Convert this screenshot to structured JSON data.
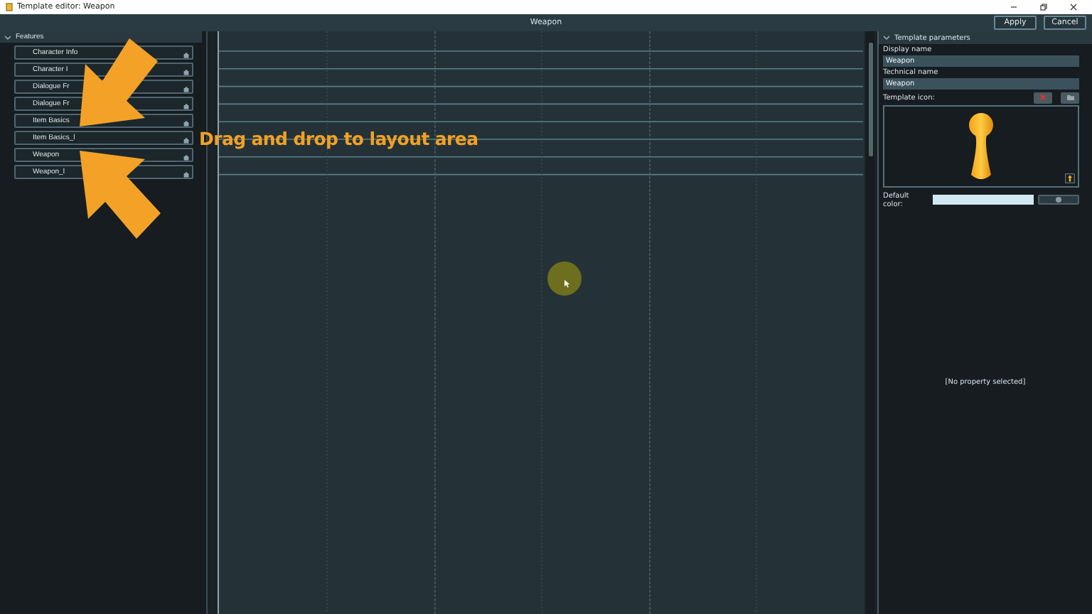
{
  "window": {
    "title": "Template editor: Weapon"
  },
  "toolbar": {
    "title": "Weapon",
    "buttons": [
      "Apply",
      "Cancel"
    ]
  },
  "features": {
    "header": "Features",
    "expanded": true,
    "items": [
      {
        "label": "Character Info"
      },
      {
        "label": "Character I"
      },
      {
        "label": "Dialogue Fr"
      },
      {
        "label": "Dialogue Fr"
      },
      {
        "label": "Item Basics"
      },
      {
        "label": "Item Basics_l"
      },
      {
        "label": "Weapon"
      },
      {
        "label": "Weapon_l"
      }
    ]
  },
  "params": {
    "header": "Template parameters",
    "expanded": true,
    "fields": [
      {
        "label": "Display name",
        "value": "Weapon"
      },
      {
        "label": "Technical name",
        "value": "Weapon"
      }
    ],
    "icon_label": "Template icon:",
    "color_label": "Default color:",
    "status": "[No property selected]"
  },
  "overlay": {
    "caption": "Drag and drop to layout area"
  }
}
